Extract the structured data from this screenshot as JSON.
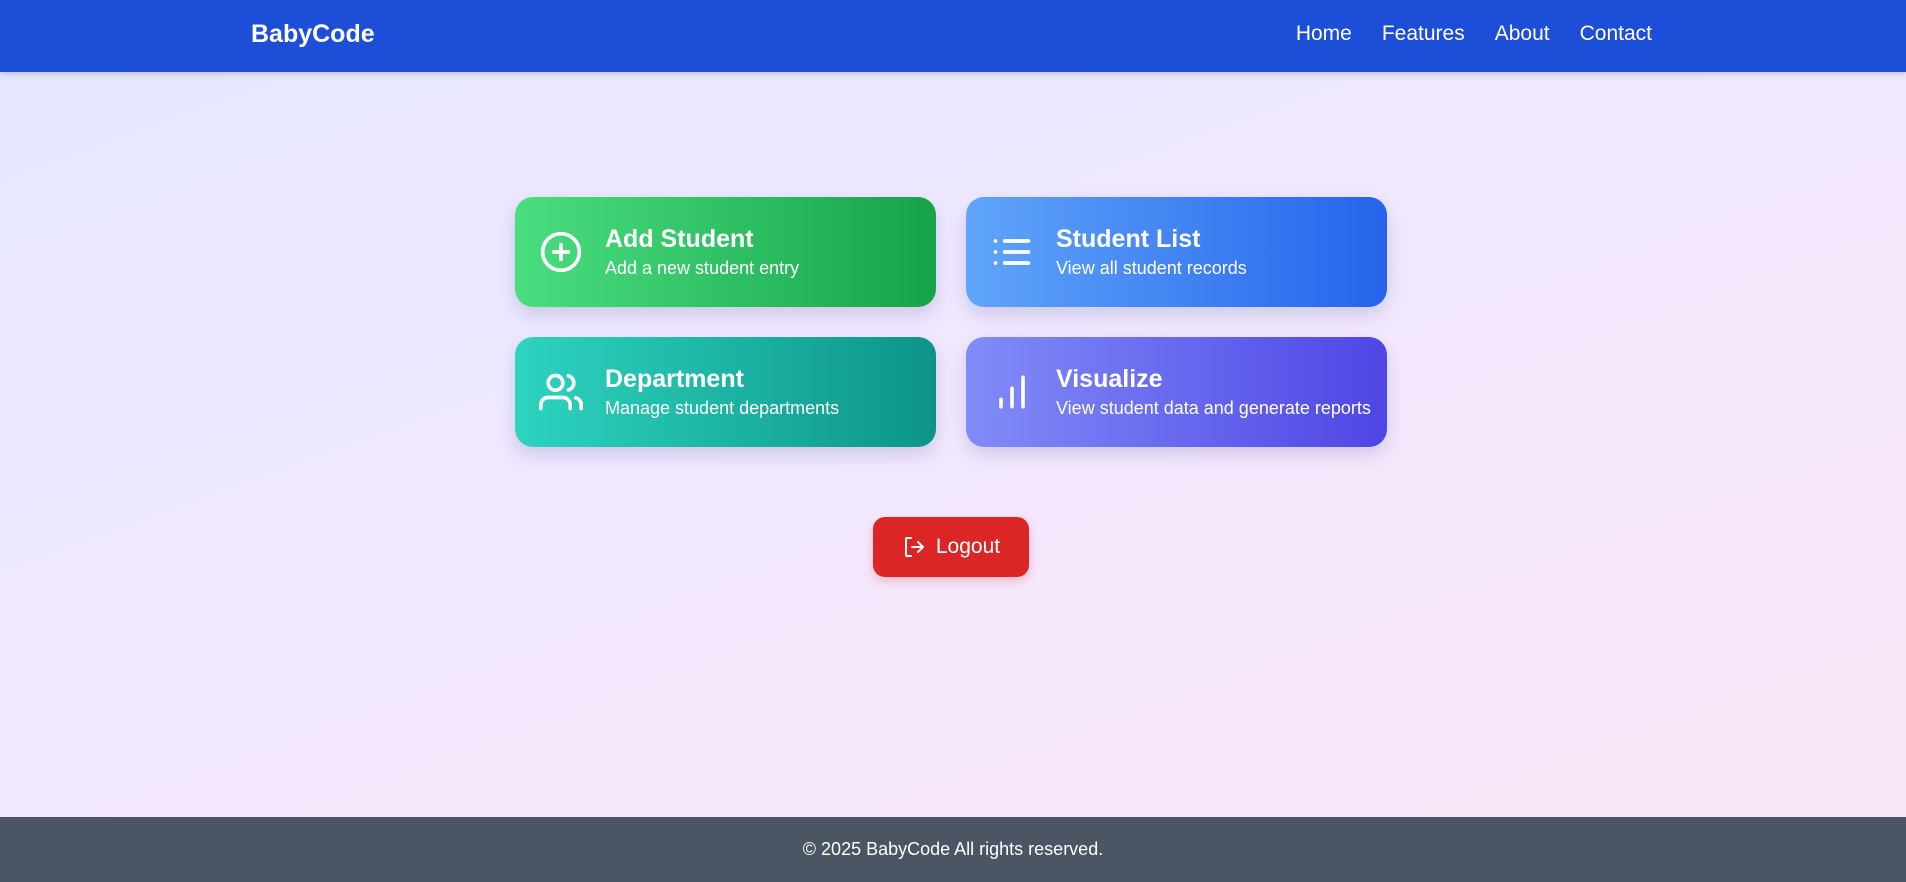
{
  "navbar": {
    "brand": "BabyCode",
    "links": [
      "Home",
      "Features",
      "About",
      "Contact"
    ],
    "background": "#1d4ed8"
  },
  "cards": [
    {
      "title": "Add Student",
      "description": "Add a new student entry",
      "icon": "plus-circle-icon",
      "colors": [
        "#4ade80",
        "#16a34a"
      ]
    },
    {
      "title": "Student List",
      "description": "View all student records",
      "icon": "list-icon",
      "colors": [
        "#60a5fa",
        "#2563eb"
      ]
    },
    {
      "title": "Department",
      "description": "Manage student departments",
      "icon": "users-icon",
      "colors": [
        "#2dd4bf",
        "#0d9488"
      ]
    },
    {
      "title": "Visualize",
      "description": "View student data and generate reports",
      "icon": "bar-chart-icon",
      "colors": [
        "#818cf8",
        "#4f46e5"
      ]
    }
  ],
  "logout": {
    "label": "Logout",
    "icon": "logout-icon",
    "color": "#dc2626"
  },
  "footer": {
    "text": "© 2025 BabyCode All rights reserved.",
    "background": "#4b5563"
  }
}
